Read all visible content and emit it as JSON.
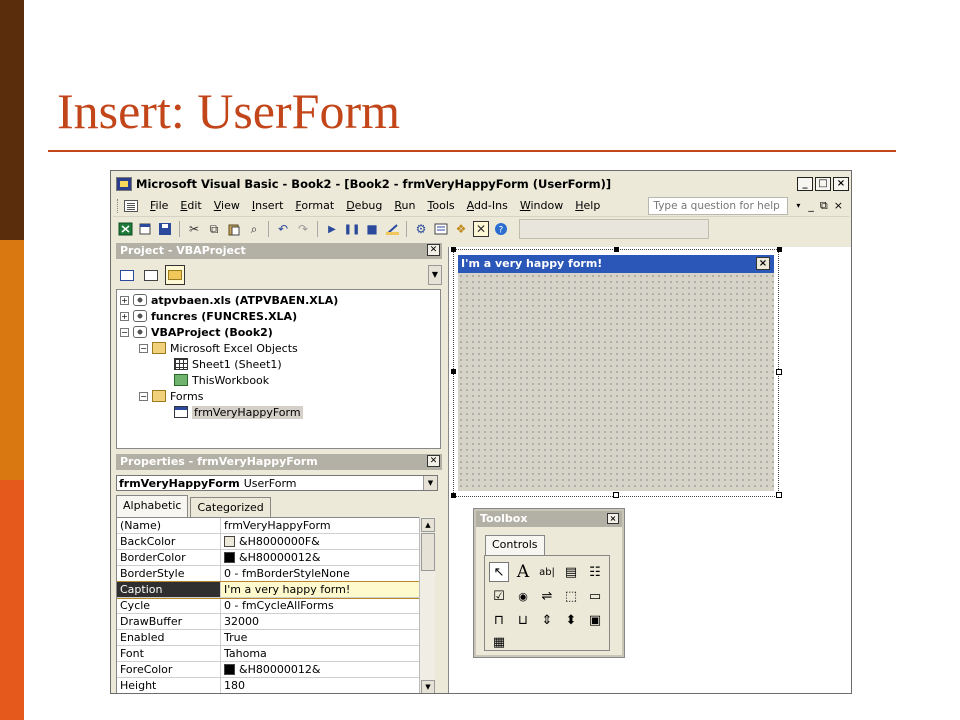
{
  "slide": {
    "title": "Insert: UserForm",
    "colors": {
      "stripe_dark": "#5a2d0c",
      "stripe_mid": "#d97810",
      "stripe_light": "#e55a1c",
      "title": "#c2461a",
      "rule": "#c2461a"
    }
  },
  "window": {
    "title": "Microsoft Visual Basic - Book2 - [Book2 - frmVeryHappyForm (UserForm)]",
    "caption_buttons": {
      "minimize": "_",
      "maximize": "□",
      "close": "×"
    }
  },
  "menubar": {
    "items": [
      "File",
      "Edit",
      "View",
      "Insert",
      "Format",
      "Debug",
      "Run",
      "Tools",
      "Add-Ins",
      "Window",
      "Help"
    ],
    "ask_placeholder": "Type a question for help",
    "ask_dropdown": "▾",
    "mdi_buttons": [
      "_",
      "⧉",
      "×"
    ]
  },
  "toolbar": {
    "icons": [
      "excel-icon",
      "insert-module-icon",
      "save-icon",
      "cut-icon",
      "copy-icon",
      "paste-icon",
      "find-icon",
      "undo-icon",
      "redo-icon",
      "run-icon",
      "break-icon",
      "reset-icon",
      "design-mode-icon",
      "project-explorer-icon",
      "properties-icon",
      "object-browser-icon",
      "toolbox-icon",
      "help-icon"
    ]
  },
  "project_panel": {
    "title": "Project - VBAProject",
    "tree": [
      {
        "label": "atpvbaen.xls (ATPVBAEN.XLA)",
        "expander": "+",
        "bold": true
      },
      {
        "label": "funcres (FUNCRES.XLA)",
        "expander": "+",
        "bold": true
      },
      {
        "label": "VBAProject (Book2)",
        "expander": "−",
        "bold": true
      },
      {
        "label": "Microsoft Excel Objects",
        "expander": "−"
      },
      {
        "label": "Sheet1 (Sheet1)"
      },
      {
        "label": "ThisWorkbook"
      },
      {
        "label": "Forms",
        "expander": "−"
      },
      {
        "label": "frmVeryHappyForm",
        "selected": true
      }
    ]
  },
  "properties_panel": {
    "title": "Properties - frmVeryHappyForm",
    "object_name": "frmVeryHappyForm",
    "object_type": "UserForm",
    "tabs": [
      "Alphabetic",
      "Categorized"
    ],
    "rows": [
      {
        "name": "(Name)",
        "value": "frmVeryHappyForm"
      },
      {
        "name": "BackColor",
        "value": "&H8000000F&",
        "swatch": "#ece9d8"
      },
      {
        "name": "BorderColor",
        "value": "&H80000012&",
        "swatch": "#000000"
      },
      {
        "name": "BorderStyle",
        "value": "0 - fmBorderStyleNone"
      },
      {
        "name": "Caption",
        "value": "I'm a very happy form!",
        "selected": true
      },
      {
        "name": "Cycle",
        "value": "0 - fmCycleAllForms"
      },
      {
        "name": "DrawBuffer",
        "value": "32000"
      },
      {
        "name": "Enabled",
        "value": "True"
      },
      {
        "name": "Font",
        "value": "Tahoma"
      },
      {
        "name": "ForeColor",
        "value": "&H80000012&",
        "swatch": "#000000"
      },
      {
        "name": "Height",
        "value": "180"
      }
    ]
  },
  "userform": {
    "caption": "I'm a very happy form!",
    "close": "×"
  },
  "toolbox": {
    "title": "Toolbox",
    "close": "×",
    "tab": "Controls",
    "tools": [
      {
        "name": "select-objects-tool",
        "glyph": "↖"
      },
      {
        "name": "label-tool",
        "glyph": "A"
      },
      {
        "name": "textbox-tool",
        "glyph": "ab|"
      },
      {
        "name": "combobox-tool",
        "glyph": "▤"
      },
      {
        "name": "listbox-tool",
        "glyph": "☷"
      },
      {
        "name": "checkbox-tool",
        "glyph": "☑"
      },
      {
        "name": "optionbutton-tool",
        "glyph": "◉"
      },
      {
        "name": "togglebutton-tool",
        "glyph": "⇌"
      },
      {
        "name": "frame-tool",
        "glyph": "⬚"
      },
      {
        "name": "commandbutton-tool",
        "glyph": "▭"
      },
      {
        "name": "tabstrip-tool",
        "glyph": "⊓"
      },
      {
        "name": "multipage-tool",
        "glyph": "⊔"
      },
      {
        "name": "scrollbar-tool",
        "glyph": "⇕"
      },
      {
        "name": "spinbutton-tool",
        "glyph": "⬍"
      },
      {
        "name": "image-tool",
        "glyph": "▣"
      },
      {
        "name": "refedit-tool",
        "glyph": "▦"
      }
    ]
  }
}
